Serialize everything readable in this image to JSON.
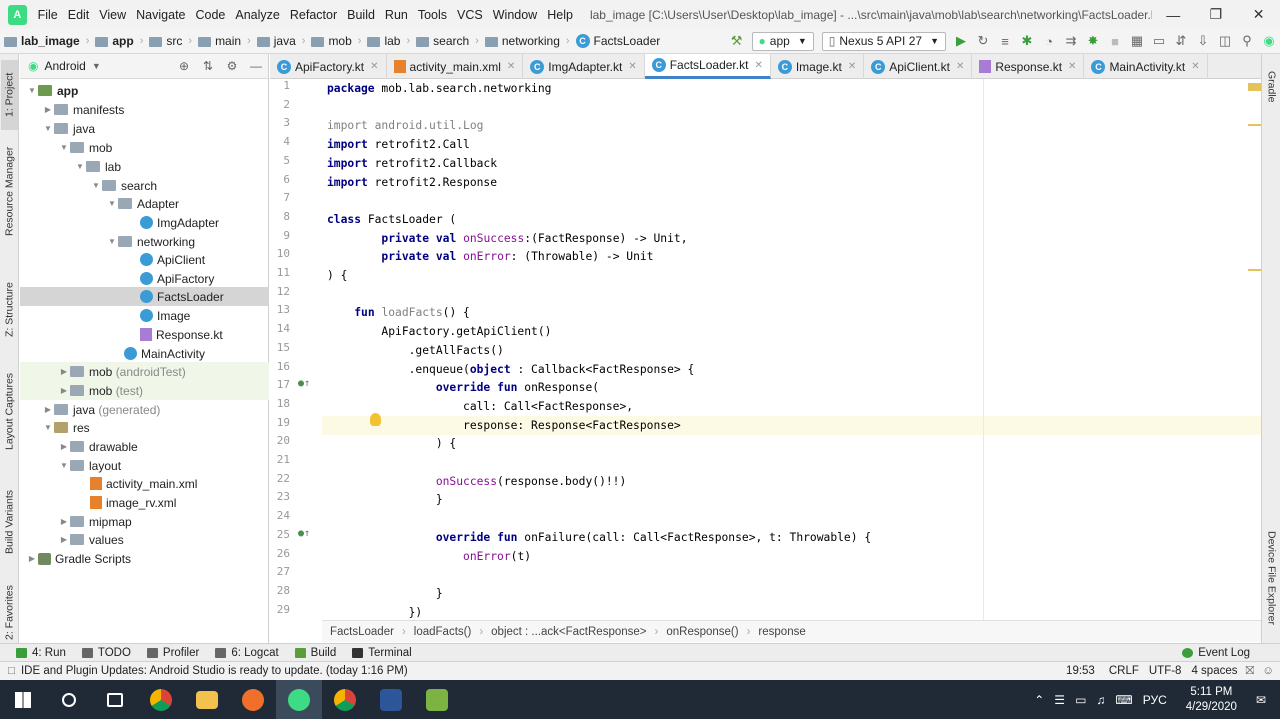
{
  "menubar": {
    "items": [
      "File",
      "Edit",
      "View",
      "Navigate",
      "Code",
      "Analyze",
      "Refactor",
      "Build",
      "Run",
      "Tools",
      "VCS",
      "Window",
      "Help"
    ],
    "title": "lab_image [C:\\Users\\User\\Desktop\\lab_image] - ...\\src\\main\\java\\mob\\lab\\search\\networking\\FactsLoader.kt [app]"
  },
  "navbar": {
    "crumbs": [
      "lab_image",
      "app",
      "src",
      "main",
      "java",
      "mob",
      "lab",
      "search",
      "networking",
      "FactsLoader"
    ],
    "run_config": "app",
    "device": "Nexus 5 API 27"
  },
  "left_strip": [
    "1: Project",
    "Resource Manager",
    "Z: Structure",
    "Layout Captures",
    "Build Variants",
    "2: Favorites"
  ],
  "right_strip": [
    "Gradle",
    "Device File Explorer"
  ],
  "project": {
    "view": "Android",
    "tree": [
      {
        "label": "app",
        "bold": true
      },
      {
        "label": "manifests"
      },
      {
        "label": "java"
      },
      {
        "label": "mob"
      },
      {
        "label": "lab"
      },
      {
        "label": "search"
      },
      {
        "label": "Adapter"
      },
      {
        "label": "ImgAdapter"
      },
      {
        "label": "networking"
      },
      {
        "label": "ApiClient"
      },
      {
        "label": "ApiFactory"
      },
      {
        "label": "FactsLoader"
      },
      {
        "label": "Image"
      },
      {
        "label": "Response.kt"
      },
      {
        "label": "MainActivity"
      },
      {
        "label": "mob",
        "suffix": "(androidTest)"
      },
      {
        "label": "mob",
        "suffix": "(test)"
      },
      {
        "label": "java",
        "suffix": "(generated)"
      },
      {
        "label": "res"
      },
      {
        "label": "drawable"
      },
      {
        "label": "layout"
      },
      {
        "label": "activity_main.xml"
      },
      {
        "label": "image_rv.xml"
      },
      {
        "label": "mipmap"
      },
      {
        "label": "values"
      },
      {
        "label": "Gradle Scripts"
      }
    ]
  },
  "tabs": [
    "ApiFactory.kt",
    "activity_main.xml",
    "ImgAdapter.kt",
    "FactsLoader.kt",
    "Image.kt",
    "ApiClient.kt",
    "Response.kt",
    "MainActivity.kt"
  ],
  "active_tab": "FactsLoader.kt",
  "code": {
    "lines": [
      "package mob.lab.search.networking",
      "",
      "import android.util.Log",
      "import retrofit2.Call",
      "import retrofit2.Callback",
      "import retrofit2.Response",
      "",
      "class FactsLoader (",
      "        private val onSuccess:(FactResponse) -> Unit,",
      "        private val onError: (Throwable) -> Unit",
      ") {",
      "",
      "    fun loadFacts() {",
      "        ApiFactory.getApiClient()",
      "            .getAllFacts()",
      "            .enqueue(object : Callback<FactResponse> {",
      "                override fun onResponse(",
      "                    call: Call<FactResponse>,",
      "                    response: Response<FactResponse>",
      "                ) {",
      "",
      "                onSuccess(response.body()!!)",
      "                }",
      "",
      "                override fun onFailure(call: Call<FactResponse>, t: Throwable) {",
      "                    onError(t)",
      "",
      "                }",
      "            })"
    ],
    "line_numbers": [
      "1",
      "2",
      "3",
      "4",
      "5",
      "6",
      "7",
      "8",
      "9",
      "10",
      "11",
      "12",
      "13",
      "14",
      "15",
      "16",
      "17",
      "18",
      "19",
      "20",
      "21",
      "22",
      "23",
      "24",
      "25",
      "26",
      "27",
      "28",
      "29"
    ]
  },
  "breadcrumb": [
    "FactsLoader",
    "loadFacts()",
    "object : ...ack<FactResponse>",
    "onResponse()",
    "response"
  ],
  "toolwindows": [
    "4: Run",
    "TODO",
    "Profiler",
    "6: Logcat",
    "Build",
    "Terminal"
  ],
  "event_log": "Event Log",
  "status": {
    "message": "IDE and Plugin Updates: Android Studio is ready to update. (today 1:16 PM)",
    "position": "19:53",
    "line_sep": "CRLF",
    "encoding": "UTF-8",
    "indent": "4 spaces"
  },
  "taskbar": {
    "lang": "РУС",
    "time": "5:11 PM",
    "date": "4/29/2020"
  },
  "colors": {
    "accent": "#4083c9",
    "kotlin": "#3b9bd6",
    "taskbar": "#1f2a36"
  }
}
